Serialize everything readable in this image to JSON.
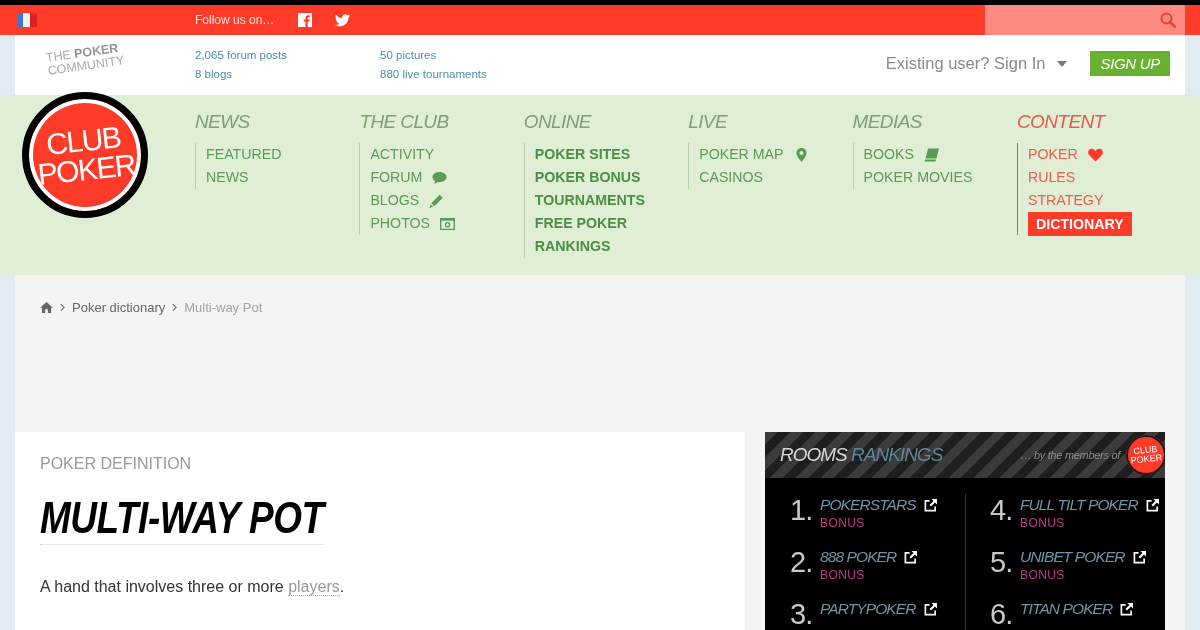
{
  "top_bar": {
    "follow_label": "Follow us on…"
  },
  "header": {
    "tagline": "THE **POKER** COMMUNITY",
    "stats_columns": [
      [
        "2,065 forum posts",
        "8 blogs"
      ],
      [
        "50 pictures",
        "880 live tournaments"
      ]
    ],
    "sign_in": "Existing user? Sign In",
    "sign_up": "SIGN UP"
  },
  "logo": {
    "text": "CLUB POKER"
  },
  "nav": {
    "sections": [
      {
        "heading": "NEWS",
        "selected": false,
        "featured": false,
        "items": [
          {
            "label": "FEATURED",
            "kind": "text",
            "selected": false
          },
          {
            "label": "NEWS",
            "kind": "text",
            "selected": false
          }
        ]
      },
      {
        "heading": "THE CLUB",
        "selected": false,
        "featured": false,
        "items": [
          {
            "label": "ACTIVITY",
            "kind": "text",
            "selected": false
          },
          {
            "label": "FORUM",
            "kind": "forum",
            "selected": false
          },
          {
            "label": "BLOGS",
            "kind": "blog",
            "selected": false
          },
          {
            "label": "PHOTOS",
            "kind": "photos",
            "selected": false
          }
        ]
      },
      {
        "heading": "ONLINE",
        "selected": false,
        "featured": true,
        "items": [
          {
            "label": "POKER SITES",
            "kind": "text",
            "selected": false
          },
          {
            "label": "POKER BONUS",
            "kind": "text",
            "selected": false
          },
          {
            "label": "TOURNAMENTS",
            "kind": "text",
            "selected": false
          },
          {
            "label": "FREE POKER",
            "kind": "text",
            "selected": false
          },
          {
            "label": "RANKINGS",
            "kind": "text",
            "selected": false
          }
        ]
      },
      {
        "heading": "LIVE",
        "selected": false,
        "featured": false,
        "items": [
          {
            "label": "POKER MAP",
            "kind": "map",
            "selected": false
          },
          {
            "label": "CASINOS",
            "kind": "text",
            "selected": false
          }
        ]
      },
      {
        "heading": "MEDIAS",
        "selected": false,
        "featured": false,
        "items": [
          {
            "label": "BOOKS",
            "kind": "books",
            "selected": false
          },
          {
            "label": "POKER MOVIES",
            "kind": "text",
            "selected": false
          }
        ]
      },
      {
        "heading": "CONTENT",
        "selected": true,
        "featured": false,
        "items": [
          {
            "label": "POKER",
            "kind": "favorite",
            "selected": false
          },
          {
            "label": "RULES",
            "kind": "text",
            "selected": false
          },
          {
            "label": "STRATEGY",
            "kind": "text",
            "selected": false
          },
          {
            "label": "DICTIONARY",
            "kind": "text",
            "selected": true
          }
        ]
      }
    ]
  },
  "breadcrumb": {
    "items": [
      {
        "label": "Poker dictionary",
        "current": false
      },
      {
        "label": "Multi-way Pot",
        "current": true
      }
    ]
  },
  "article": {
    "eyebrow": "POKER DEFINITION",
    "title": "MULTI-WAY POT",
    "definition": {
      "before": "A hand that involves three or more ",
      "link": "players",
      "after": "."
    }
  },
  "rankings": {
    "title": "ROOMS",
    "title_accent": "RANKINGS",
    "byline": "… by the members of",
    "badge_logo": "CLUB POKER",
    "rooms": [
      {
        "rank": "1.",
        "name": "POKERSTARS",
        "bonus": "BONUS"
      },
      {
        "rank": "2.",
        "name": "888 POKER",
        "bonus": "BONUS"
      },
      {
        "rank": "3.",
        "name": "PARTYPOKER"
      },
      {
        "rank": "4.",
        "name": "FULL TILT POKER",
        "bonus": "BONUS"
      },
      {
        "rank": "5.",
        "name": "UNIBET POKER",
        "bonus": "BONUS"
      },
      {
        "rank": "6.",
        "name": "TITAN POKER"
      }
    ]
  }
}
